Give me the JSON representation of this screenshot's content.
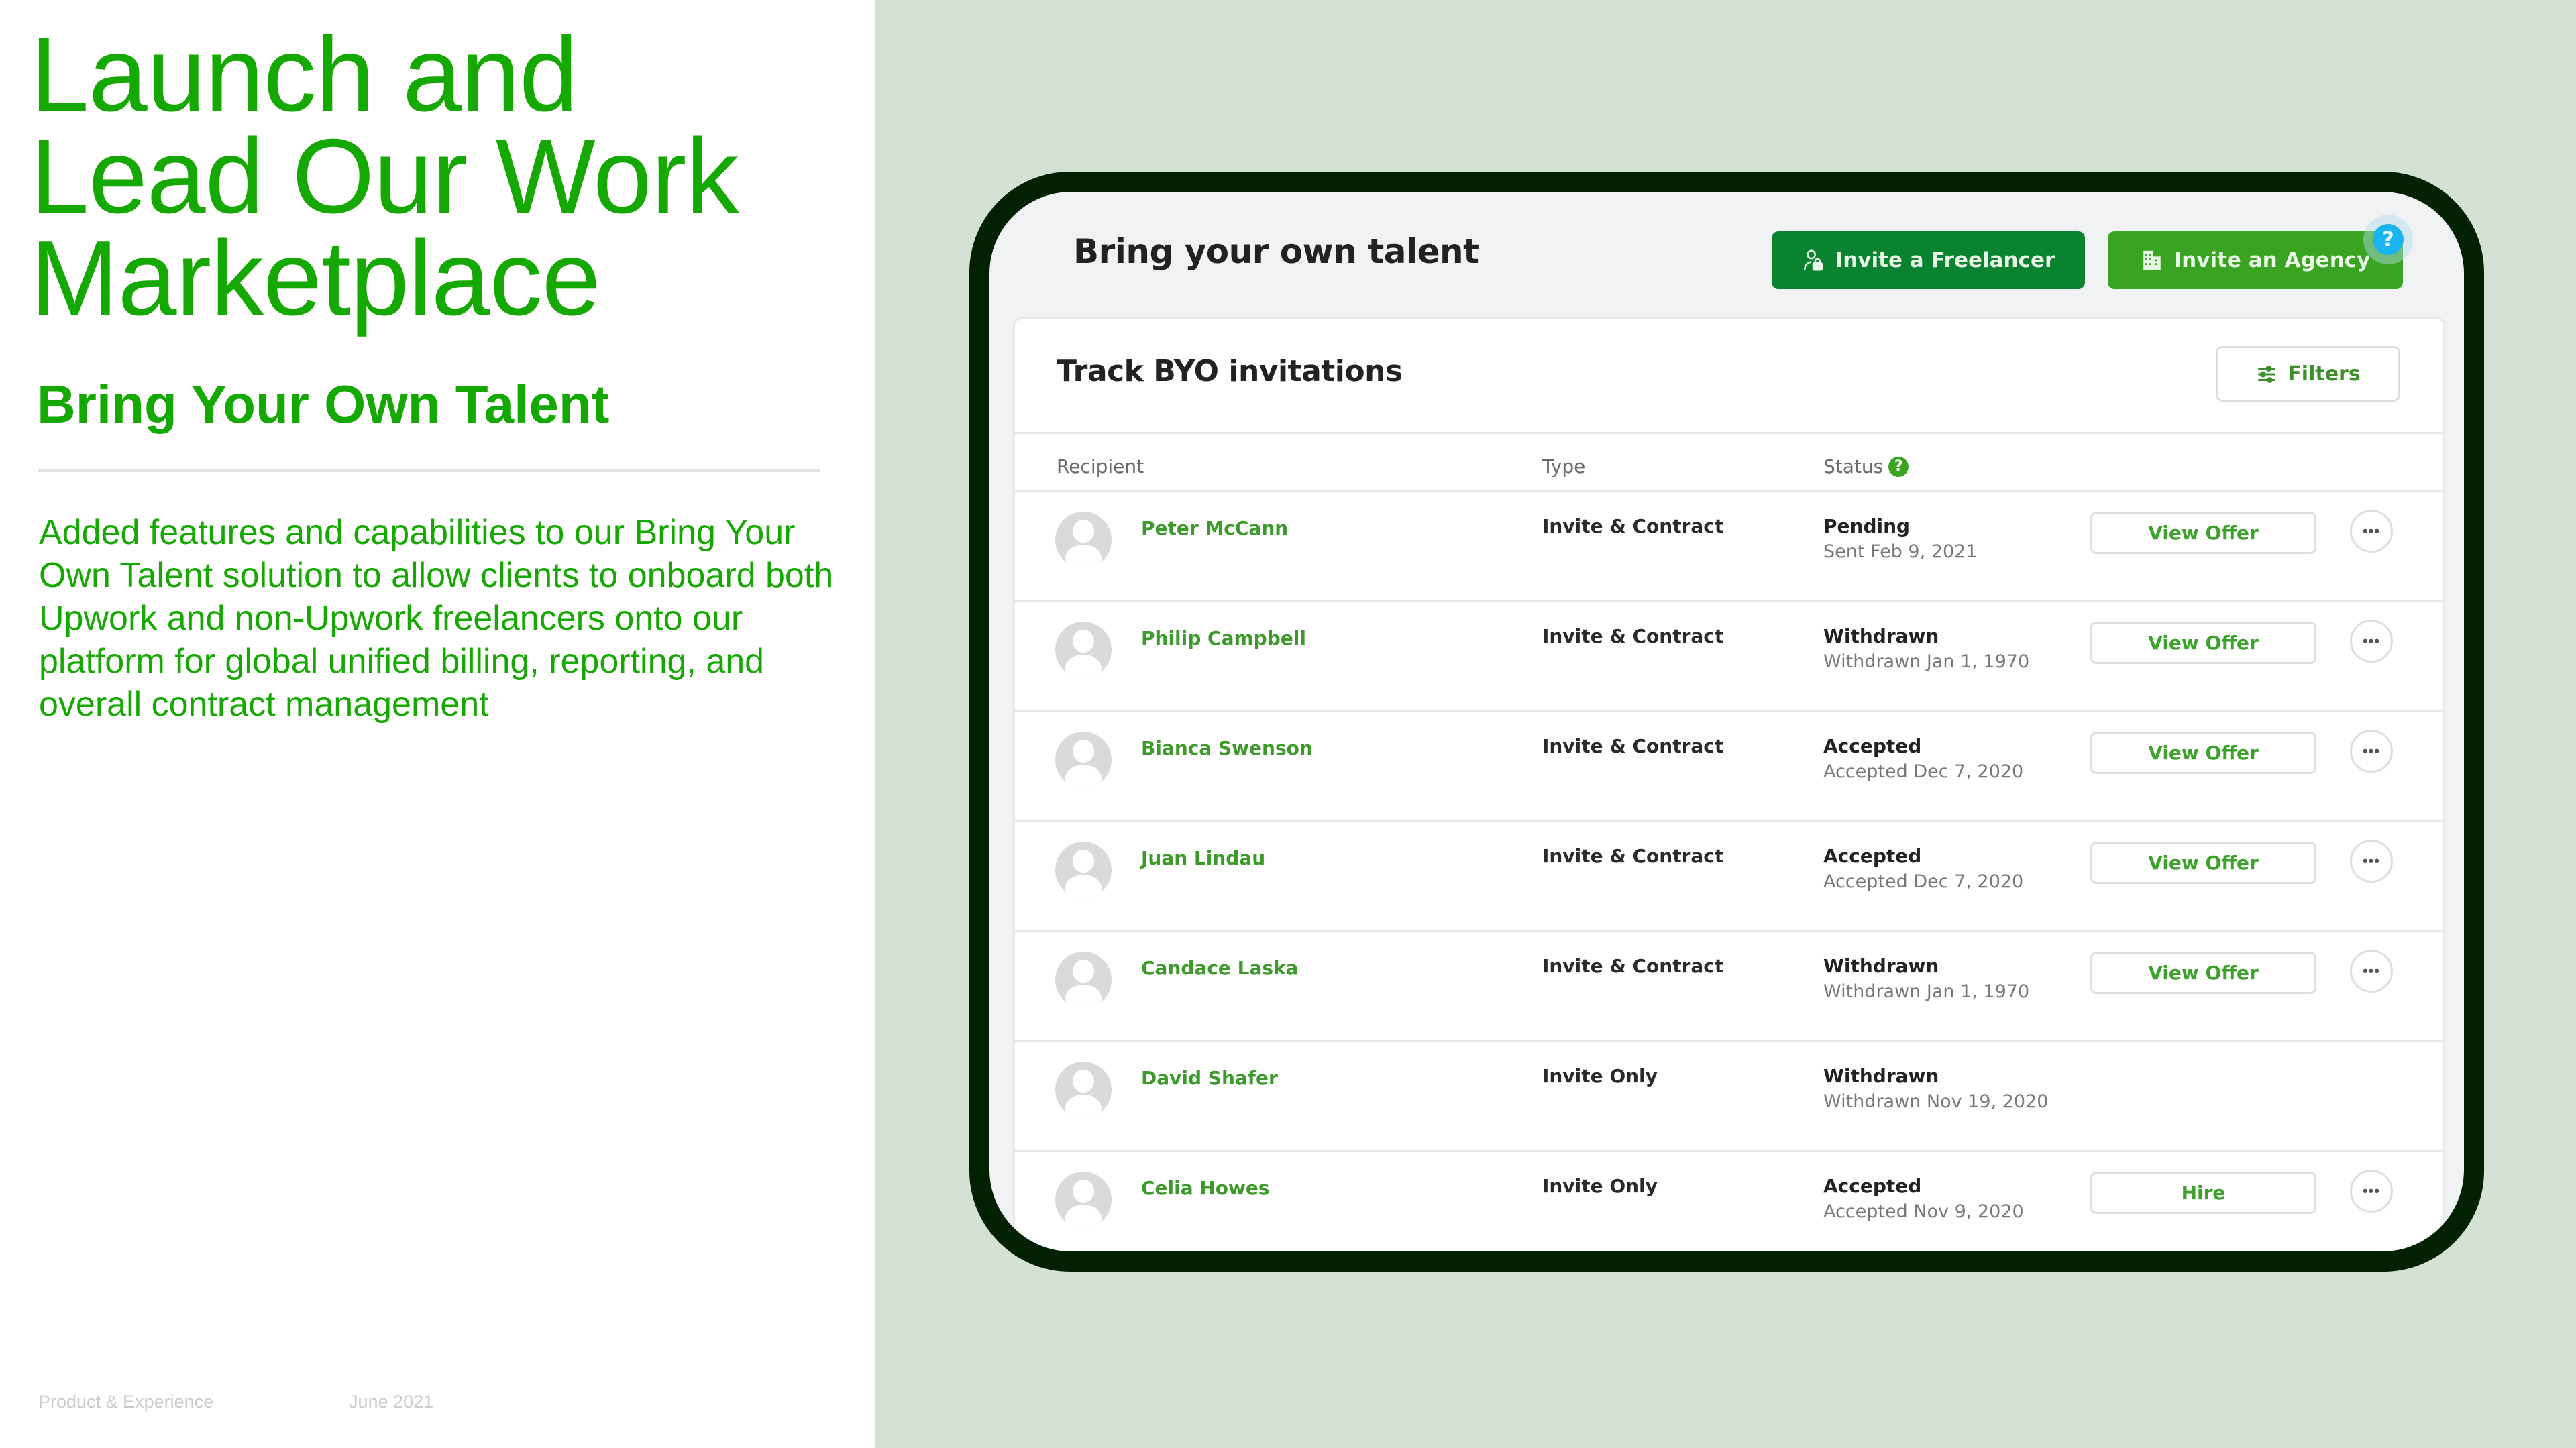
{
  "slide": {
    "title_lines": [
      "Launch and",
      "Lead Our Work",
      "Marketplace"
    ],
    "subtitle": "Bring Your Own Talent",
    "body": "Added features and capabilities to our Bring Your Own Talent solution to allow clients to onboard both Upwork and non-Upwork freelancers onto our platform for global unified billing, reporting, and overall contract management",
    "footer_left": "Product & Experience",
    "footer_right": "June 2021"
  },
  "colors": {
    "brand_green": "#14a800",
    "device_frame": "#022102",
    "right_bg": "#d6e1d6",
    "primary_button": "#0a8330",
    "secondary_button": "#3aa422",
    "help_badge": "#1ab4f0"
  },
  "app": {
    "title": "Bring your own talent",
    "invite_freelancer_label": "Invite a Freelancer",
    "invite_freelancer_icon": "user-lock-icon",
    "invite_agency_label": "Invite an Agency",
    "invite_agency_icon": "building-icon",
    "help_badge": "?",
    "card": {
      "title": "Track BYO invitations",
      "filters_label": "Filters",
      "filters_icon": "sliders-icon",
      "columns": {
        "recipient": "Recipient",
        "type": "Type",
        "status": "Status",
        "status_help": "?"
      },
      "rows": [
        {
          "name": "Peter McCann",
          "type": "Invite & Contract",
          "status": "Pending",
          "status_date": "Sent Feb 9, 2021",
          "action": "View Offer",
          "more": "•••"
        },
        {
          "name": "Philip Campbell",
          "type": "Invite & Contract",
          "status": "Withdrawn",
          "status_date": "Withdrawn Jan 1, 1970",
          "action": "View Offer",
          "more": "•••"
        },
        {
          "name": "Bianca Swenson",
          "type": "Invite & Contract",
          "status": "Accepted",
          "status_date": "Accepted Dec 7, 2020",
          "action": "View Offer",
          "more": "•••"
        },
        {
          "name": "Juan Lindau",
          "type": "Invite & Contract",
          "status": "Accepted",
          "status_date": "Accepted Dec 7, 2020",
          "action": "View Offer",
          "more": "•••"
        },
        {
          "name": "Candace Laska",
          "type": "Invite & Contract",
          "status": "Withdrawn",
          "status_date": "Withdrawn Jan 1, 1970",
          "action": "View Offer",
          "more": "•••"
        },
        {
          "name": "David Shafer",
          "type": "Invite Only",
          "status": "Withdrawn",
          "status_date": "Withdrawn Nov 19, 2020",
          "action": null,
          "more": null
        },
        {
          "name": "Celia Howes",
          "type": "Invite Only",
          "status": "Accepted",
          "status_date": "Accepted Nov 9, 2020",
          "action": "Hire",
          "more": "•••"
        }
      ]
    }
  }
}
